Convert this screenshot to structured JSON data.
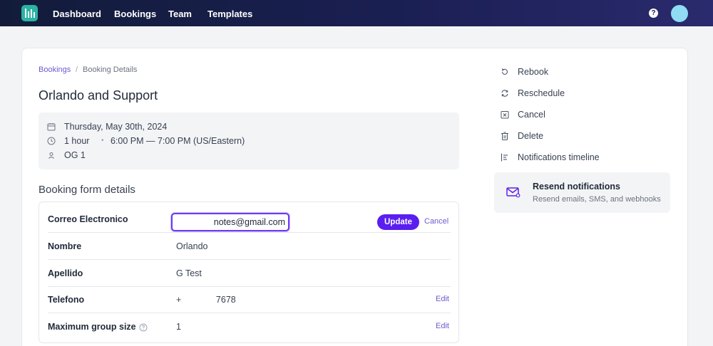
{
  "nav": {
    "items": [
      "Dashboard",
      "Bookings",
      "Team",
      "Templates"
    ],
    "help_glyph": "?"
  },
  "breadcrumb": {
    "parent": "Bookings",
    "separator": "/",
    "current": "Booking Details"
  },
  "booking": {
    "title": "Orlando and Support",
    "date": "Thursday, May 30th, 2024",
    "duration": "1 hour",
    "time_separator": "•",
    "time": "6:00 PM — 7:00 PM (US/Eastern)",
    "attendee": "OG 1"
  },
  "form": {
    "section_title": "Booking form details",
    "email": {
      "label": "Correo Electronico",
      "value": "notes@gmail.com",
      "update_label": "Update",
      "cancel_label": "Cancel"
    },
    "rows": [
      {
        "label": "Nombre",
        "value": "Orlando"
      },
      {
        "label": "Apellido",
        "value": "G Test"
      },
      {
        "label": "Telefono",
        "value": "+              7678",
        "edit_label": "Edit"
      },
      {
        "label": "Maximum group size",
        "value": "1",
        "edit_label": "Edit"
      }
    ]
  },
  "actions": [
    {
      "label": "Rebook",
      "icon": "rebook-icon"
    },
    {
      "label": "Reschedule",
      "icon": "reschedule-icon"
    },
    {
      "label": "Cancel",
      "icon": "cancel-box-icon"
    },
    {
      "label": "Delete",
      "icon": "trash-icon"
    },
    {
      "label": "Notifications timeline",
      "icon": "timeline-icon"
    }
  ],
  "resend": {
    "title": "Resend notifications",
    "subtitle": "Resend emails, SMS, and webhooks",
    "icon": "mail-icon"
  },
  "colors": {
    "accent": "#5b1ef0",
    "link": "#6d5bd0",
    "logo": "#2bb3a3",
    "avatar": "#8fdcf3"
  }
}
